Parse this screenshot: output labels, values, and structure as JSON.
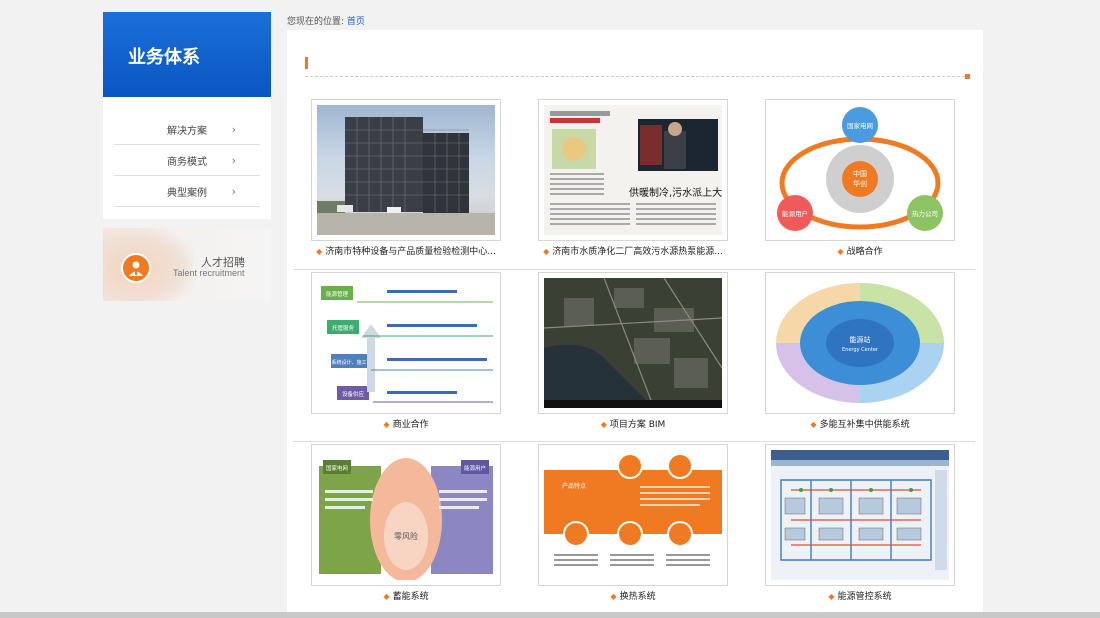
{
  "sidebar": {
    "title": "业务体系",
    "items": [
      {
        "label": "解决方案",
        "chevron": "›"
      },
      {
        "label": "商务模式",
        "chevron": "›"
      },
      {
        "label": "典型案例",
        "chevron": "›"
      }
    ],
    "talent": {
      "title_cn": "人才招聘",
      "title_en": "Talent recruitment",
      "icon": "recruiter-icon"
    }
  },
  "breadcrumb": {
    "prefix": "您现在的位置:",
    "home": "首页"
  },
  "cards": [
    {
      "caption": "济南市特种设备与产品质量检验检测中心...",
      "image": "office-building-photo"
    },
    {
      "caption": "济南市水质净化二厂高效污水源热泵能源...",
      "image": "newspaper-clipping"
    },
    {
      "caption": "战略合作",
      "image": "strategy-diagram",
      "diagram": {
        "top": "国家电网",
        "center_1": "中国",
        "center_2": "华创",
        "left": "能源用户",
        "right": "热力公司"
      }
    },
    {
      "caption": "商业合作",
      "image": "business-flow-diagram",
      "diagram": {
        "steps": [
          "能源管理",
          "托管服务",
          "系统设计、施工",
          "设备供应"
        ]
      }
    },
    {
      "caption": "项目方案 BIM",
      "image": "satellite-map"
    },
    {
      "caption": "多能互补集中供能系统",
      "image": "energy-center-diagram",
      "diagram": {
        "center": "能源站",
        "center_en": "Energy Center"
      }
    },
    {
      "caption": "蓄能系统",
      "image": "storage-diagram",
      "diagram": {
        "left": "国家电网",
        "right": "能源用户",
        "center": "零风险"
      }
    },
    {
      "caption": "换热系统",
      "image": "heat-exchange-diagram",
      "diagram": {
        "title": "产品特点"
      }
    },
    {
      "caption": "能源管控系统",
      "image": "control-system-schematic"
    }
  ],
  "colors": {
    "brand_blue": "#0a56c2",
    "accent_orange": "#f07a21",
    "link_blue": "#1a5ec4"
  }
}
